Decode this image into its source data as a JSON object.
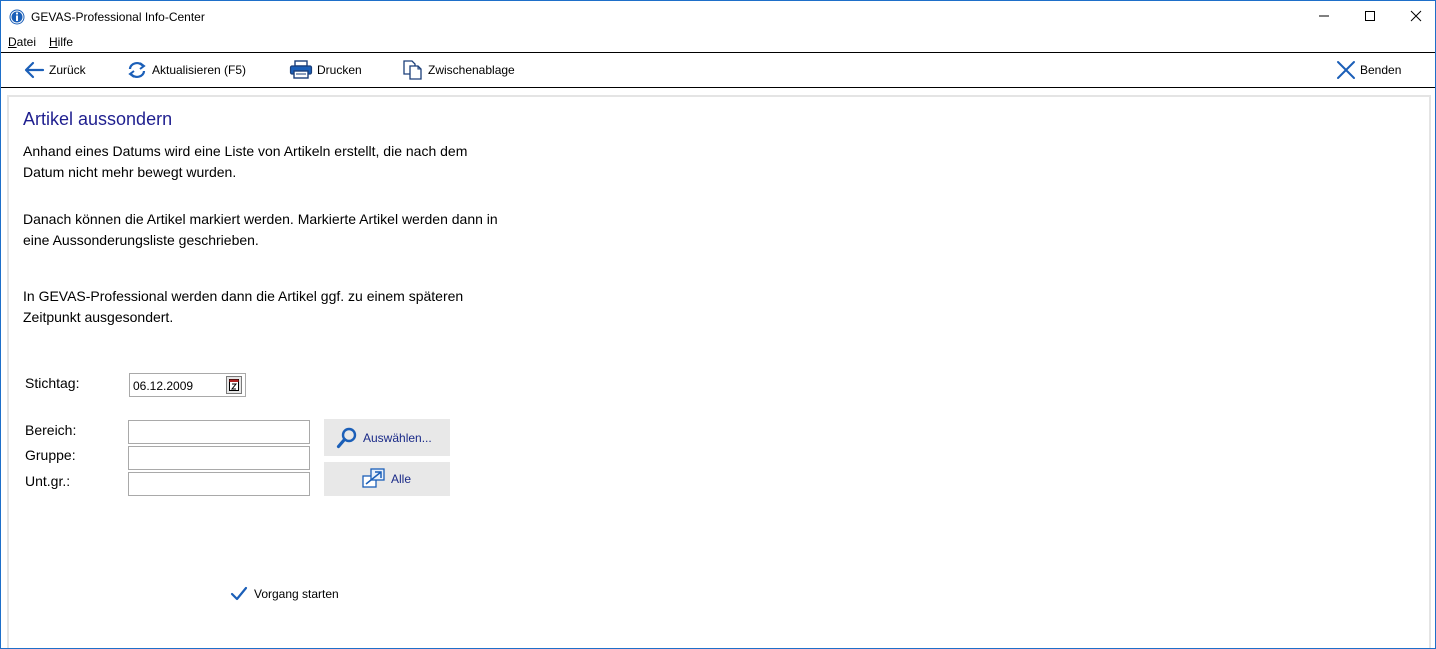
{
  "window": {
    "title": "GEVAS-Professional Info-Center"
  },
  "menu": {
    "datei_accel": "D",
    "datei_rest": "atei",
    "hilfe_accel": "H",
    "hilfe_rest": "ilfe"
  },
  "toolbar": {
    "back": "Zurück",
    "refresh": "Aktualisieren (F5)",
    "print": "Drucken",
    "clipboard": "Zwischenablage",
    "close": "Benden"
  },
  "content": {
    "heading": "Artikel aussondern",
    "paragraph1": "Anhand eines Datums wird eine Liste von Artikeln erstellt, die nach dem Datum nicht mehr bewegt wurden.",
    "paragraph2": "Danach können die Artikel markiert werden. Markierte Artikel werden dann in eine Aussonderungsliste geschrieben.",
    "paragraph3": "In GEVAS-Professional werden dann die Artikel ggf. zu einem späteren Zeitpunkt ausgesondert."
  },
  "form": {
    "stichtag_label": "Stichtag:",
    "stichtag_value": "06.12.2009",
    "bereich_label": "Bereich:",
    "bereich_value": "",
    "gruppe_label": "Gruppe:",
    "gruppe_value": "",
    "untgr_label": "Unt.gr.:",
    "untgr_value": "",
    "select_button": "Auswählen...",
    "all_button": "Alle",
    "start_button": "Vorgang starten"
  },
  "colors": {
    "heading": "#1f1f8f",
    "accent_blue": "#1e6fc9",
    "button_bg": "#e8e8e8"
  }
}
